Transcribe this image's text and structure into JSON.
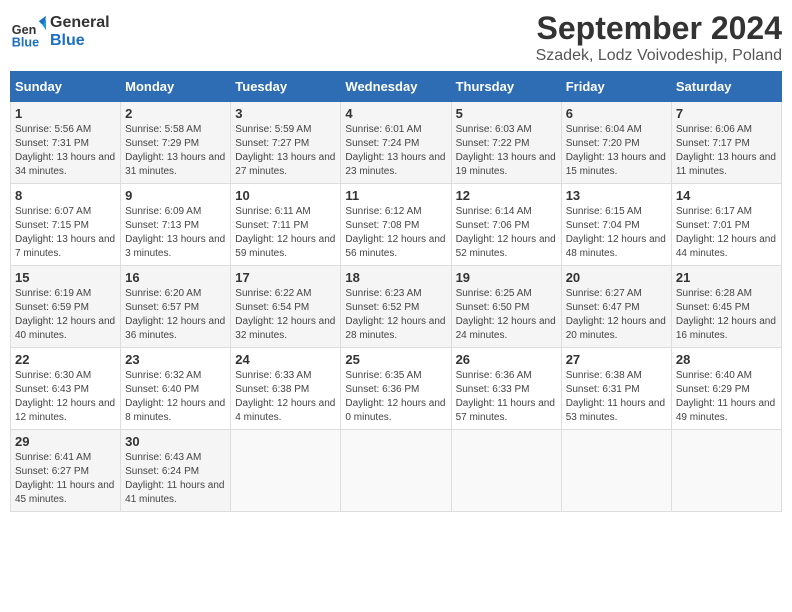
{
  "header": {
    "logo_line1": "General",
    "logo_line2": "Blue",
    "title": "September 2024",
    "subtitle": "Szadek, Lodz Voivodeship, Poland"
  },
  "days_of_week": [
    "Sunday",
    "Monday",
    "Tuesday",
    "Wednesday",
    "Thursday",
    "Friday",
    "Saturday"
  ],
  "weeks": [
    [
      {
        "day": "1",
        "sunrise": "5:56 AM",
        "sunset": "7:31 PM",
        "daylight": "13 hours and 34 minutes."
      },
      {
        "day": "2",
        "sunrise": "5:58 AM",
        "sunset": "7:29 PM",
        "daylight": "13 hours and 31 minutes."
      },
      {
        "day": "3",
        "sunrise": "5:59 AM",
        "sunset": "7:27 PM",
        "daylight": "13 hours and 27 minutes."
      },
      {
        "day": "4",
        "sunrise": "6:01 AM",
        "sunset": "7:24 PM",
        "daylight": "13 hours and 23 minutes."
      },
      {
        "day": "5",
        "sunrise": "6:03 AM",
        "sunset": "7:22 PM",
        "daylight": "13 hours and 19 minutes."
      },
      {
        "day": "6",
        "sunrise": "6:04 AM",
        "sunset": "7:20 PM",
        "daylight": "13 hours and 15 minutes."
      },
      {
        "day": "7",
        "sunrise": "6:06 AM",
        "sunset": "7:17 PM",
        "daylight": "13 hours and 11 minutes."
      }
    ],
    [
      {
        "day": "8",
        "sunrise": "6:07 AM",
        "sunset": "7:15 PM",
        "daylight": "13 hours and 7 minutes."
      },
      {
        "day": "9",
        "sunrise": "6:09 AM",
        "sunset": "7:13 PM",
        "daylight": "13 hours and 3 minutes."
      },
      {
        "day": "10",
        "sunrise": "6:11 AM",
        "sunset": "7:11 PM",
        "daylight": "12 hours and 59 minutes."
      },
      {
        "day": "11",
        "sunrise": "6:12 AM",
        "sunset": "7:08 PM",
        "daylight": "12 hours and 56 minutes."
      },
      {
        "day": "12",
        "sunrise": "6:14 AM",
        "sunset": "7:06 PM",
        "daylight": "12 hours and 52 minutes."
      },
      {
        "day": "13",
        "sunrise": "6:15 AM",
        "sunset": "7:04 PM",
        "daylight": "12 hours and 48 minutes."
      },
      {
        "day": "14",
        "sunrise": "6:17 AM",
        "sunset": "7:01 PM",
        "daylight": "12 hours and 44 minutes."
      }
    ],
    [
      {
        "day": "15",
        "sunrise": "6:19 AM",
        "sunset": "6:59 PM",
        "daylight": "12 hours and 40 minutes."
      },
      {
        "day": "16",
        "sunrise": "6:20 AM",
        "sunset": "6:57 PM",
        "daylight": "12 hours and 36 minutes."
      },
      {
        "day": "17",
        "sunrise": "6:22 AM",
        "sunset": "6:54 PM",
        "daylight": "12 hours and 32 minutes."
      },
      {
        "day": "18",
        "sunrise": "6:23 AM",
        "sunset": "6:52 PM",
        "daylight": "12 hours and 28 minutes."
      },
      {
        "day": "19",
        "sunrise": "6:25 AM",
        "sunset": "6:50 PM",
        "daylight": "12 hours and 24 minutes."
      },
      {
        "day": "20",
        "sunrise": "6:27 AM",
        "sunset": "6:47 PM",
        "daylight": "12 hours and 20 minutes."
      },
      {
        "day": "21",
        "sunrise": "6:28 AM",
        "sunset": "6:45 PM",
        "daylight": "12 hours and 16 minutes."
      }
    ],
    [
      {
        "day": "22",
        "sunrise": "6:30 AM",
        "sunset": "6:43 PM",
        "daylight": "12 hours and 12 minutes."
      },
      {
        "day": "23",
        "sunrise": "6:32 AM",
        "sunset": "6:40 PM",
        "daylight": "12 hours and 8 minutes."
      },
      {
        "day": "24",
        "sunrise": "6:33 AM",
        "sunset": "6:38 PM",
        "daylight": "12 hours and 4 minutes."
      },
      {
        "day": "25",
        "sunrise": "6:35 AM",
        "sunset": "6:36 PM",
        "daylight": "12 hours and 0 minutes."
      },
      {
        "day": "26",
        "sunrise": "6:36 AM",
        "sunset": "6:33 PM",
        "daylight": "11 hours and 57 minutes."
      },
      {
        "day": "27",
        "sunrise": "6:38 AM",
        "sunset": "6:31 PM",
        "daylight": "11 hours and 53 minutes."
      },
      {
        "day": "28",
        "sunrise": "6:40 AM",
        "sunset": "6:29 PM",
        "daylight": "11 hours and 49 minutes."
      }
    ],
    [
      {
        "day": "29",
        "sunrise": "6:41 AM",
        "sunset": "6:27 PM",
        "daylight": "11 hours and 45 minutes."
      },
      {
        "day": "30",
        "sunrise": "6:43 AM",
        "sunset": "6:24 PM",
        "daylight": "11 hours and 41 minutes."
      },
      null,
      null,
      null,
      null,
      null
    ]
  ]
}
